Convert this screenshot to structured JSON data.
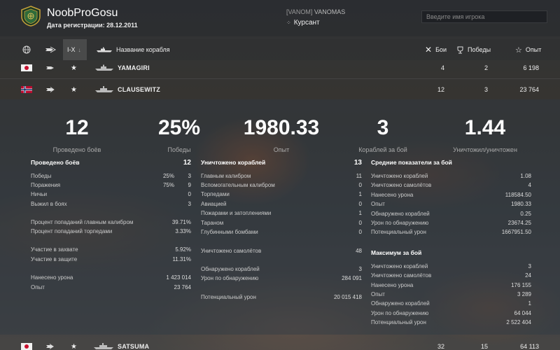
{
  "header": {
    "player_name": "NoobProGosu",
    "registration": "Дата регистрации: 28.12.2011",
    "clan_tag": "[VANOM]",
    "clan_name": "VANOMAS",
    "rank": "Курсант",
    "search_placeholder": "Введите имя игрока"
  },
  "columns": {
    "tier_filter": "I-X",
    "ship_name": "Название корабля",
    "battles": "Бои",
    "wins": "Победы",
    "exp": "Опыт"
  },
  "ships": [
    {
      "flag": "japan-flag",
      "name": "YAMAGIRI",
      "battles": "4",
      "wins": "2",
      "exp": "6 198"
    },
    {
      "flag": "norway-flag",
      "name": "CLAUSEWITZ",
      "battles": "12",
      "wins": "3",
      "exp": "23 764"
    },
    {
      "flag": "japan-flag",
      "name": "SATSUMA",
      "battles": "32",
      "wins": "15",
      "exp": "64 113"
    }
  ],
  "summary": [
    {
      "value": "12",
      "label": "Проведено боёв"
    },
    {
      "value": "25%",
      "label": "Победы"
    },
    {
      "value": "1980.33",
      "label": "Опыт"
    },
    {
      "value": "3",
      "label": "Кораблей за бой"
    },
    {
      "value": "1.44",
      "label": "Уничтожил/уничтожен"
    }
  ],
  "battles_block": {
    "title": "Проведено боёв",
    "total": "12",
    "rows": [
      {
        "label": "Победы",
        "pct": "25%",
        "value": "3"
      },
      {
        "label": "Поражения",
        "pct": "75%",
        "value": "9"
      },
      {
        "label": "Ничьи",
        "pct": "",
        "value": "0"
      },
      {
        "label": "Выжил в боях",
        "pct": "",
        "value": "3"
      },
      {
        "label": "Процент попаданий главным калибром",
        "pct": "",
        "value": "39.71%"
      },
      {
        "label": "Процент попаданий торпедами",
        "pct": "",
        "value": "3.33%"
      },
      {
        "label": "Участие в захвате",
        "pct": "",
        "value": "5.92%"
      },
      {
        "label": "Участие в защите",
        "pct": "",
        "value": "11.31%"
      },
      {
        "label": "Нанесено урона",
        "pct": "",
        "value": "1 423 014"
      },
      {
        "label": "Опыт",
        "pct": "",
        "value": "23 764"
      }
    ]
  },
  "destroyed_block": {
    "title": "Уничтожено кораблей",
    "total": "13",
    "rows": [
      {
        "label": "Главным калибром",
        "value": "11"
      },
      {
        "label": "Вспомогательным калибром",
        "value": "0"
      },
      {
        "label": "Торпедами",
        "value": "1"
      },
      {
        "label": "Авиацией",
        "value": "0"
      },
      {
        "label": "Пожарами и затоплениями",
        "value": "1"
      },
      {
        "label": "Тараном",
        "value": "0"
      },
      {
        "label": "Глубинными бомбами",
        "value": "0"
      },
      {
        "label": "Уничтожено самолётов",
        "value": "48"
      },
      {
        "label": "Обнаружено кораблей",
        "value": "3"
      },
      {
        "label": "Урон по обнаружению",
        "value": "284 091"
      },
      {
        "label": "Потенциальный урон",
        "value": "20 015 418"
      }
    ]
  },
  "average_block": {
    "title": "Средние показатели за бой",
    "rows": [
      {
        "label": "Уничтожено кораблей",
        "value": "1.08"
      },
      {
        "label": "Уничтожено самолётов",
        "value": "4"
      },
      {
        "label": "Нанесено урона",
        "value": "118584.50"
      },
      {
        "label": "Опыт",
        "value": "1980.33"
      },
      {
        "label": "Обнаружено кораблей",
        "value": "0.25"
      },
      {
        "label": "Урон по обнаружению",
        "value": "23674.25"
      },
      {
        "label": "Потенциальный урон",
        "value": "1667951.50"
      }
    ]
  },
  "max_block": {
    "title": "Максимум за бой",
    "rows": [
      {
        "label": "Уничтожено кораблей",
        "value": "3"
      },
      {
        "label": "Уничтожено самолётов",
        "value": "24"
      },
      {
        "label": "Нанесено урона",
        "value": "176 155"
      },
      {
        "label": "Опыт",
        "value": "3 289"
      },
      {
        "label": "Обнаружено кораблей",
        "value": "1"
      },
      {
        "label": "Урон по обнаружению",
        "value": "64 044"
      },
      {
        "label": "Потенциальный урон",
        "value": "2 522 404"
      }
    ]
  },
  "colors": {
    "accent": "#ffffff",
    "emblem_gold": "#c8a23a",
    "emblem_green": "#2f6b3a"
  }
}
